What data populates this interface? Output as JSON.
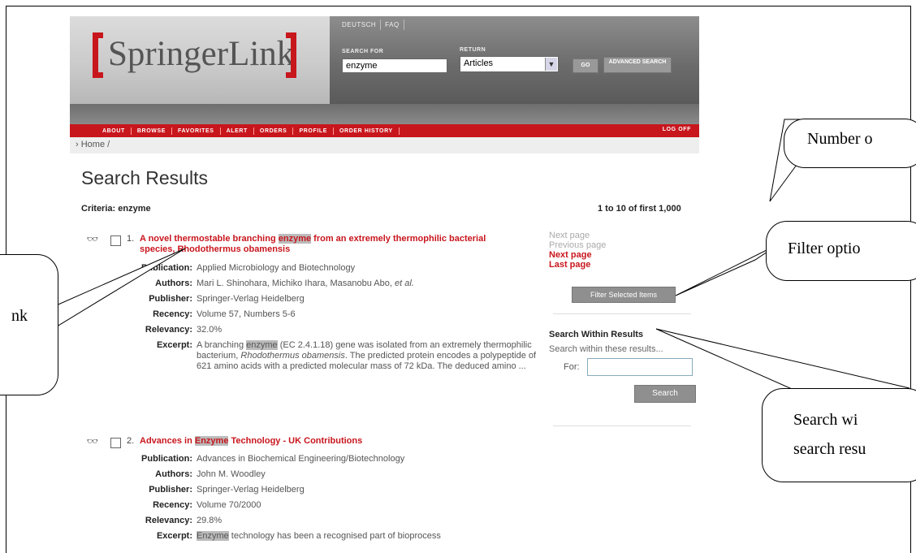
{
  "header": {
    "logo_text": "SpringerLink",
    "top_links": [
      "DEUTSCH",
      "FAQ"
    ],
    "search_for_label": "SEARCH FOR",
    "search_value": "enzyme",
    "return_label": "RETURN",
    "return_value": "Articles",
    "go_label": "GO",
    "advanced_label": "ADVANCED SEARCH",
    "nav_items": [
      "ABOUT",
      "BROWSE",
      "FAVORITES",
      "ALERT",
      "ORDERS",
      "PROFILE",
      "ORDER HISTORY"
    ],
    "logoff_label": "LOG OFF"
  },
  "breadcrumb": "› Home /",
  "page_title": "Search Results",
  "criteria": "Criteria: enzyme",
  "result_count": "1 to 10 of first 1,000",
  "results": [
    {
      "number": "1.",
      "title_pre": "A novel thermostable branching ",
      "title_hl": "enzyme",
      "title_post": " from an extremely thermophilic bacterial species, Rhodothermus obamensis",
      "publication": "Applied Microbiology and Biotechnology",
      "authors_main": "Mari L. Shinohara, Michiko Ihara, Masanobu Abo, ",
      "authors_etal": "et al.",
      "publisher": "Springer-Verlag Heidelberg",
      "recency": "Volume 57, Numbers 5-6",
      "relevancy": "32.0%",
      "excerpt_pre": "A branching ",
      "excerpt_hl": "enzyme",
      "excerpt_mid": " (EC 2.4.1.18) gene was isolated from an extremely thermophilic bacterium, ",
      "excerpt_it": "Rhodothermus obamensis",
      "excerpt_post": ". The predicted protein encodes a polypeptide of 621 amino acids with a predicted molecular mass of 72 kDa. The deduced amino ..."
    },
    {
      "number": "2.",
      "title_pre": "Advances in ",
      "title_hl": "Enzyme",
      "title_post": " Technology - UK Contributions",
      "publication": "Advances in Biochemical Engineering/Biotechnology",
      "authors": "John M. Woodley",
      "publisher": "Springer-Verlag Heidelberg",
      "recency": "Volume 70/2000",
      "relevancy": "29.8%",
      "excerpt_hl": "Enzyme",
      "excerpt_post": " technology has been a recognised part of bioprocess"
    }
  ],
  "field_labels": {
    "publication": "Publication:",
    "authors": "Authors:",
    "publisher": "Publisher:",
    "recency": "Recency:",
    "relevancy": "Relevancy:",
    "excerpt": "Excerpt:"
  },
  "sidebar": {
    "next_page_disabled": "Next page",
    "previous_page_disabled": "Previous page",
    "next_page": "Next page",
    "last_page": "Last page",
    "filter_button": "Filter Selected Items",
    "search_within_title": "Search Within Results",
    "search_within_desc": "Search within these results...",
    "for_label": "For:",
    "search_button": "Search"
  },
  "callouts": {
    "number_of": "Number o",
    "filter": "Filter optio",
    "link": "nk",
    "search_within_line1": "Search wi",
    "search_within_line2": "search resu"
  },
  "colors": {
    "brand_red": "#c8161d",
    "highlight": "#bbbbbb"
  }
}
